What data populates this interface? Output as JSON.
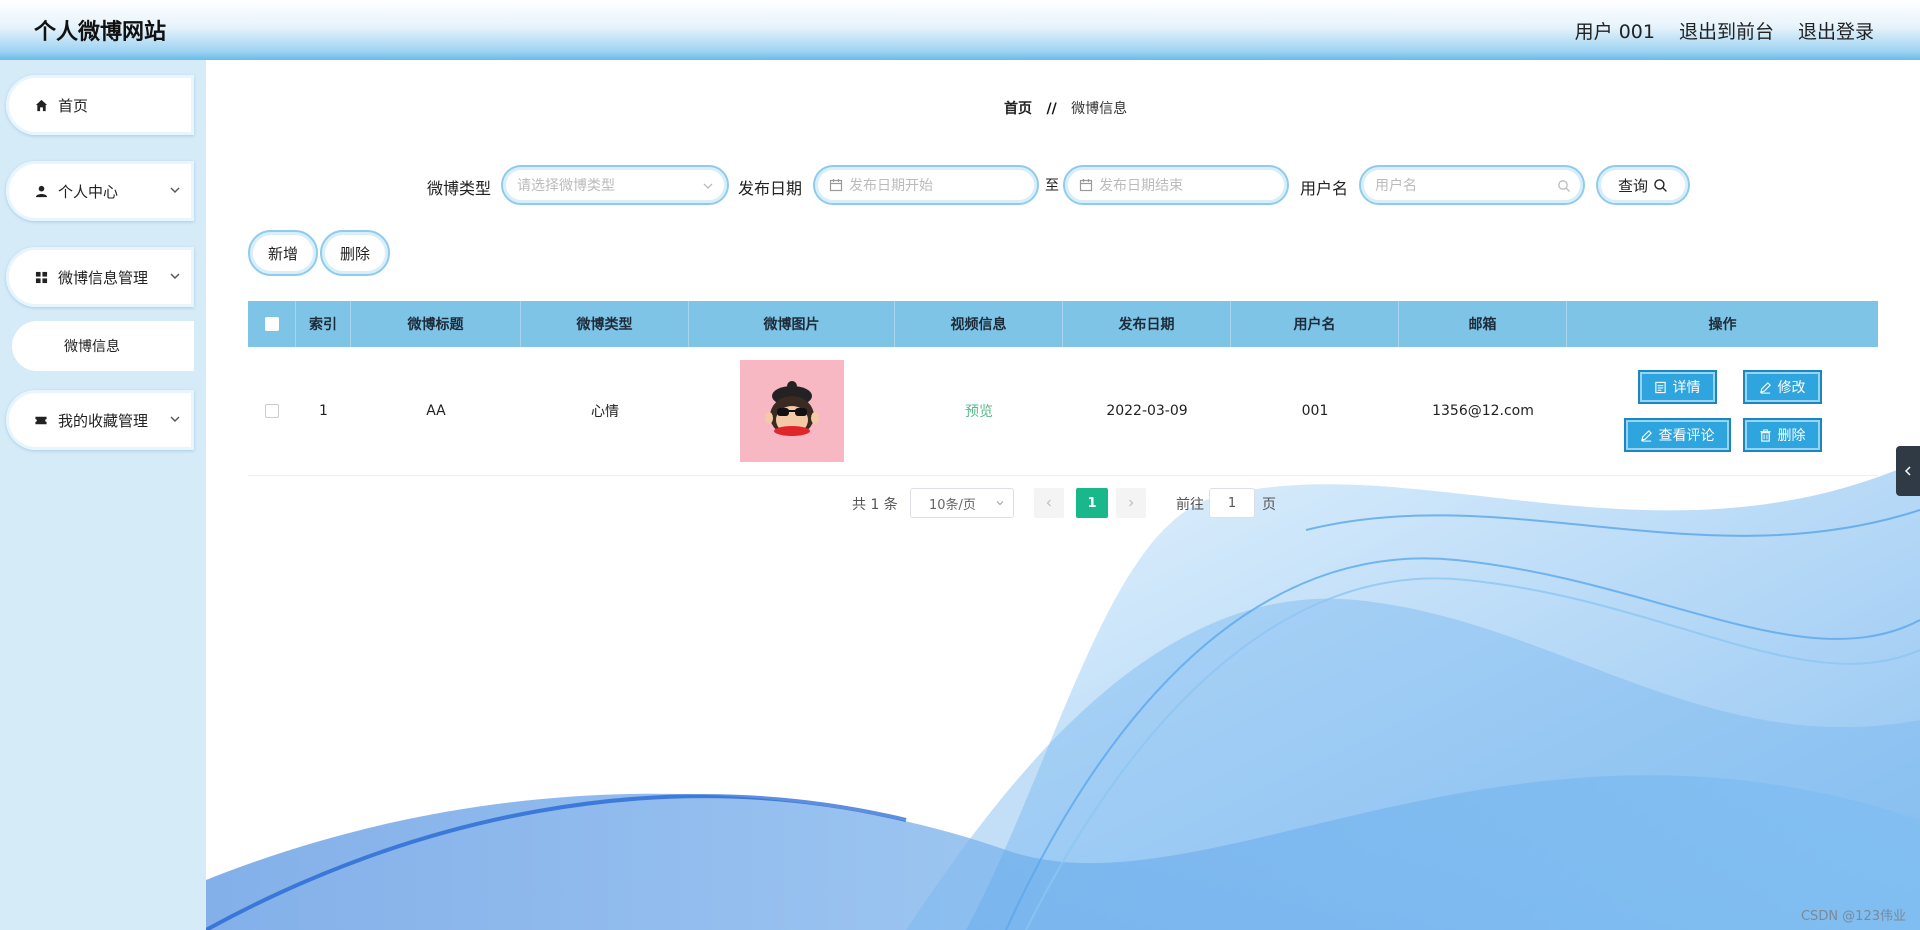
{
  "header": {
    "site_title": "个人微博网站",
    "user_label": "用户 001",
    "back_to_front": "退出到前台",
    "logout": "退出登录"
  },
  "sidebar": {
    "items": [
      {
        "label": "首页",
        "icon": "home-icon"
      },
      {
        "label": "个人中心",
        "icon": "user-icon"
      },
      {
        "label": "微博信息管理",
        "icon": "grid-icon"
      },
      {
        "label": "我的收藏管理",
        "icon": "ticket-icon"
      }
    ],
    "subitem": "微博信息"
  },
  "breadcrumb": {
    "home": "首页",
    "separator": "//",
    "current": "微博信息"
  },
  "search": {
    "type_label": "微博类型",
    "type_placeholder": "请选择微博类型",
    "date_label": "发布日期",
    "date_start_placeholder": "发布日期开始",
    "date_to": "至",
    "date_end_placeholder": "发布日期结束",
    "username_label": "用户名",
    "username_placeholder": "用户名",
    "query_button": "查询"
  },
  "actions": {
    "add": "新增",
    "delete": "删除"
  },
  "table": {
    "columns": [
      "索引",
      "微博标题",
      "微博类型",
      "微博图片",
      "视频信息",
      "发布日期",
      "用户名",
      "邮箱",
      "操作"
    ],
    "rows": [
      {
        "index": "1",
        "title": "AA",
        "type": "心情",
        "video": "预览",
        "date": "2022-03-09",
        "username": "001",
        "email": "1356@12.com"
      }
    ],
    "ops": {
      "detail": "详情",
      "edit": "修改",
      "comments": "查看评论",
      "delete": "删除"
    }
  },
  "pagination": {
    "total": "共 1 条",
    "page_size": "10条/页",
    "current_page": "1",
    "goto_label": "前往",
    "goto_value": "1",
    "page_suffix": "页"
  },
  "watermark": "CSDN @123伟业",
  "colors": {
    "table_header": "#7ec4e6",
    "op_button": "#2ea5de",
    "active_page": "#18b88a",
    "sidebar_bg": "#d6ebf8"
  }
}
